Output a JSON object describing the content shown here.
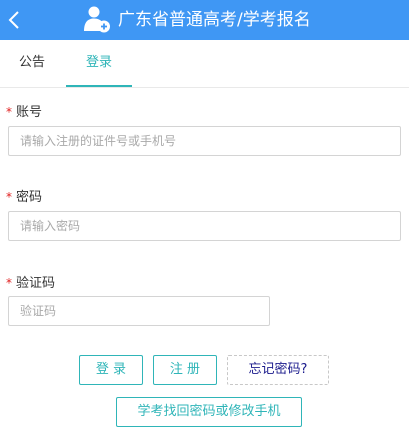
{
  "header": {
    "back_icon": "chevron-left-icon",
    "user_icon": "user-add-icon",
    "title": "广东省普通高考/学考报名"
  },
  "tabs": [
    {
      "label": "公告",
      "active": false
    },
    {
      "label": "登录",
      "active": true
    }
  ],
  "form": {
    "required_mark": "*",
    "account": {
      "label": "账号",
      "value": "",
      "placeholder": "请输入注册的证件号或手机号"
    },
    "password": {
      "label": "密码",
      "value": "",
      "placeholder": "请输入密码"
    },
    "captcha": {
      "label": "验证码",
      "value": "",
      "placeholder": "验证码"
    }
  },
  "buttons": {
    "login": "登 录",
    "register": "注 册",
    "forgot": "忘记密码?",
    "retrieve": "学考找回密码或修改手机"
  },
  "colors": {
    "header_bg": "#3f97f4",
    "accent": "#2fb5b8",
    "required": "#e02020",
    "forgot_text": "#1a1a8c"
  }
}
